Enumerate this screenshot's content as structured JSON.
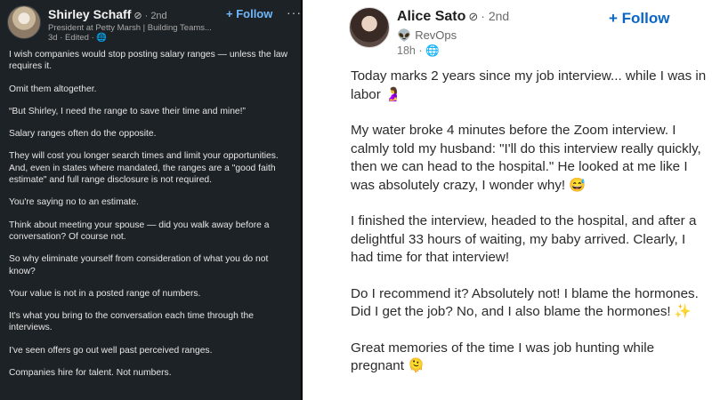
{
  "left_post": {
    "author": {
      "name": "Shirley Schaff",
      "verified_icon": "verified-icon",
      "degree": "· 2nd",
      "headline": "President at Petty Marsh | Building Teams...",
      "meta": "3d · Edited · ",
      "globe_icon": "globe-icon"
    },
    "follow_label": "+ Follow",
    "more_label": "···",
    "paragraphs": [
      "I wish companies would stop posting salary ranges — unless the law requires it.",
      "Omit them altogether.",
      "“But Shirley, I need the range to save their time and mine!”",
      "Salary ranges often do the opposite.",
      "They will cost you longer search times and limit your opportunities. And, even in states where mandated, the ranges are a \"good faith estimate\" and full range disclosure is not required.",
      "You're saying no to an estimate.",
      "Think about meeting your spouse — did you walk away before a conversation? Of course not.",
      "So why eliminate yourself from consideration of what you do not know?",
      "Your value is not in a posted range of numbers.",
      "It's what you bring to the conversation each time through the interviews.",
      "I've seen offers go out well past perceived ranges.",
      "Companies hire for talent. Not numbers."
    ]
  },
  "right_post": {
    "author": {
      "name": "Alice Sato",
      "degree": "· 2nd",
      "org": "RevOps",
      "time": "18h · "
    },
    "follow_label": "+ Follow",
    "paragraphs": [
      "Today marks 2 years since my job interview... while I was in labor 🤰",
      "My water broke 4 minutes before the Zoom interview. I calmly told my husband: \"I'll do this interview really quickly,  then we can head to the hospital.\" He looked at me like I was absolutely crazy, I wonder why! 😅",
      "I finished the interview, headed to the hospital, and after a delightful 33 hours of waiting, my baby arrived. Clearly, I had time for that interview!",
      "Do I recommend it? Absolutely not! I blame the hormones. Did I get the job? No, and I also blame the hormones! ✨",
      "Great memories of the time I was job hunting while pregnant 🫠"
    ]
  },
  "colors": {
    "left_bg": "#1d2226",
    "right_bg": "#ffffff",
    "left_follow": "#71b7fb",
    "right_follow": "#0a66c2"
  }
}
